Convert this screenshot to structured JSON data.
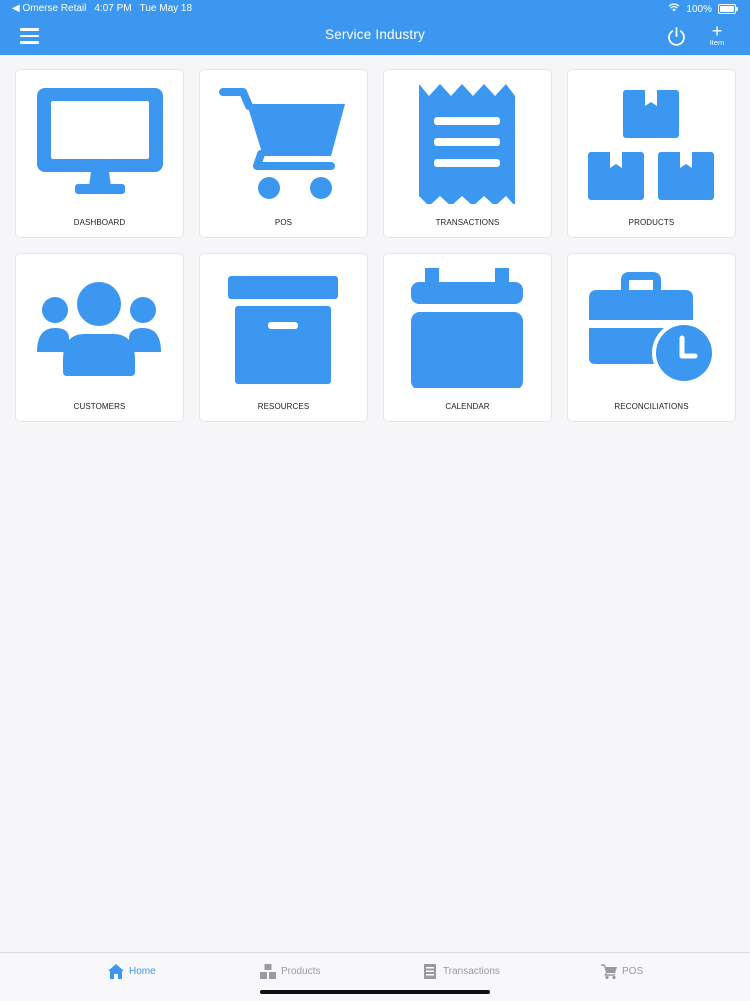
{
  "status_bar": {
    "back_app": "◀ Omerse Retail",
    "time": "4:07 PM",
    "date": "Tue May 18",
    "battery": "100%"
  },
  "header": {
    "title": "Service Industry",
    "add_item_label": "Item",
    "add_item_symbol": "+"
  },
  "tiles": [
    {
      "label": "DASHBOARD",
      "icon": "monitor-icon"
    },
    {
      "label": "POS",
      "icon": "shopping-cart-icon"
    },
    {
      "label": "TRANSACTIONS",
      "icon": "receipt-icon"
    },
    {
      "label": "PRODUCTS",
      "icon": "boxes-icon"
    },
    {
      "label": "CUSTOMERS",
      "icon": "users-icon"
    },
    {
      "label": "RESOURCES",
      "icon": "archive-box-icon"
    },
    {
      "label": "CALENDAR",
      "icon": "calendar-icon"
    },
    {
      "label": "RECONCILIATIONS",
      "icon": "briefcase-clock-icon"
    }
  ],
  "tab_bar": {
    "items": [
      {
        "label": "Home",
        "icon": "home-icon",
        "active": true
      },
      {
        "label": "Products",
        "icon": "boxes-icon",
        "active": false
      },
      {
        "label": "Transactions",
        "icon": "receipt-icon",
        "active": false
      },
      {
        "label": "POS",
        "icon": "cart-icon",
        "active": false
      }
    ]
  },
  "colors": {
    "accent": "#3b97f0",
    "background": "#f6f6f8",
    "tile_background": "#ffffff",
    "inactive_tab": "#9a9a9e"
  }
}
